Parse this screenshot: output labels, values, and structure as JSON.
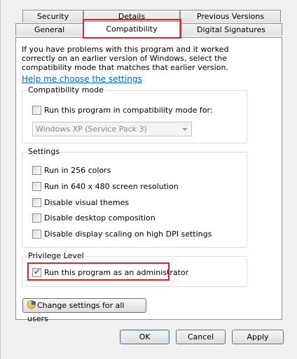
{
  "tabs": {
    "security": "Security",
    "details": "Details",
    "previous_versions": "Previous Versions",
    "general": "General",
    "compatibility": "Compatibility",
    "digital_signatures": "Digital Signatures"
  },
  "description": "If you have problems with this program and it worked correctly on an earlier version of Windows, select the compatibility mode that matches that earlier version.",
  "help_link": "Help me choose the settings",
  "compat_group": {
    "title": "Compatibility mode",
    "checkbox_label": "Run this program in compatibility mode for:",
    "checked": false,
    "select_value": "Windows XP (Service Pack 3)"
  },
  "settings_group": {
    "title": "Settings",
    "items": [
      {
        "label": "Run in 256 colors",
        "checked": false
      },
      {
        "label": "Run in 640 x 480 screen resolution",
        "checked": false
      },
      {
        "label": "Disable visual themes",
        "checked": false
      },
      {
        "label": "Disable desktop composition",
        "checked": false
      },
      {
        "label": "Disable display scaling on high DPI settings",
        "checked": false
      }
    ]
  },
  "privilege_group": {
    "title": "Privilege Level",
    "checkbox_label": "Run this program as an administrator",
    "checked": true
  },
  "change_all_users_button": "Change settings for all users",
  "buttons": {
    "ok": "OK",
    "cancel": "Cancel",
    "apply": "Apply"
  },
  "colors": {
    "highlight": "#e0212a",
    "link": "#0066cc"
  }
}
